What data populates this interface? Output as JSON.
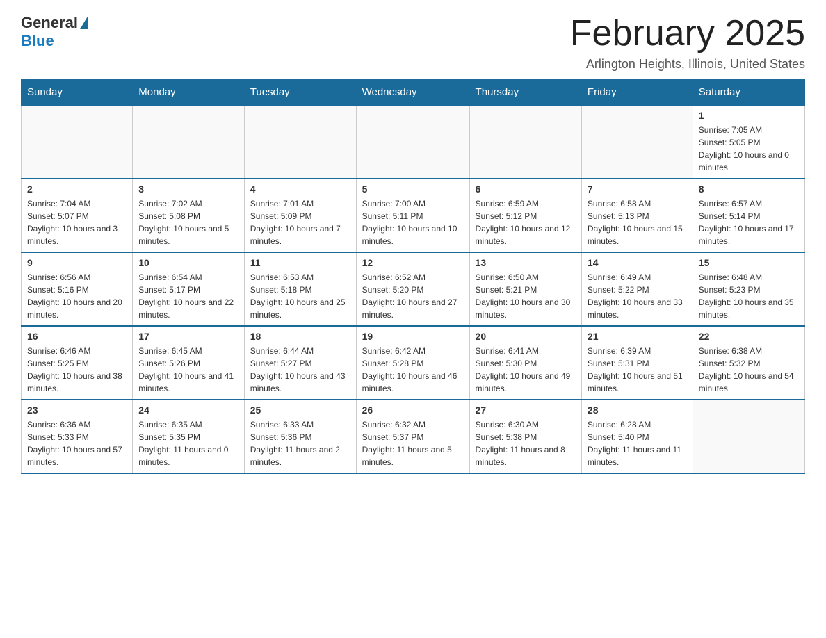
{
  "header": {
    "logo_general": "General",
    "logo_blue": "Blue",
    "month_title": "February 2025",
    "location": "Arlington Heights, Illinois, United States"
  },
  "days_of_week": [
    "Sunday",
    "Monday",
    "Tuesday",
    "Wednesday",
    "Thursday",
    "Friday",
    "Saturday"
  ],
  "weeks": [
    [
      {
        "day": "",
        "info": ""
      },
      {
        "day": "",
        "info": ""
      },
      {
        "day": "",
        "info": ""
      },
      {
        "day": "",
        "info": ""
      },
      {
        "day": "",
        "info": ""
      },
      {
        "day": "",
        "info": ""
      },
      {
        "day": "1",
        "info": "Sunrise: 7:05 AM\nSunset: 5:05 PM\nDaylight: 10 hours and 0 minutes."
      }
    ],
    [
      {
        "day": "2",
        "info": "Sunrise: 7:04 AM\nSunset: 5:07 PM\nDaylight: 10 hours and 3 minutes."
      },
      {
        "day": "3",
        "info": "Sunrise: 7:02 AM\nSunset: 5:08 PM\nDaylight: 10 hours and 5 minutes."
      },
      {
        "day": "4",
        "info": "Sunrise: 7:01 AM\nSunset: 5:09 PM\nDaylight: 10 hours and 7 minutes."
      },
      {
        "day": "5",
        "info": "Sunrise: 7:00 AM\nSunset: 5:11 PM\nDaylight: 10 hours and 10 minutes."
      },
      {
        "day": "6",
        "info": "Sunrise: 6:59 AM\nSunset: 5:12 PM\nDaylight: 10 hours and 12 minutes."
      },
      {
        "day": "7",
        "info": "Sunrise: 6:58 AM\nSunset: 5:13 PM\nDaylight: 10 hours and 15 minutes."
      },
      {
        "day": "8",
        "info": "Sunrise: 6:57 AM\nSunset: 5:14 PM\nDaylight: 10 hours and 17 minutes."
      }
    ],
    [
      {
        "day": "9",
        "info": "Sunrise: 6:56 AM\nSunset: 5:16 PM\nDaylight: 10 hours and 20 minutes."
      },
      {
        "day": "10",
        "info": "Sunrise: 6:54 AM\nSunset: 5:17 PM\nDaylight: 10 hours and 22 minutes."
      },
      {
        "day": "11",
        "info": "Sunrise: 6:53 AM\nSunset: 5:18 PM\nDaylight: 10 hours and 25 minutes."
      },
      {
        "day": "12",
        "info": "Sunrise: 6:52 AM\nSunset: 5:20 PM\nDaylight: 10 hours and 27 minutes."
      },
      {
        "day": "13",
        "info": "Sunrise: 6:50 AM\nSunset: 5:21 PM\nDaylight: 10 hours and 30 minutes."
      },
      {
        "day": "14",
        "info": "Sunrise: 6:49 AM\nSunset: 5:22 PM\nDaylight: 10 hours and 33 minutes."
      },
      {
        "day": "15",
        "info": "Sunrise: 6:48 AM\nSunset: 5:23 PM\nDaylight: 10 hours and 35 minutes."
      }
    ],
    [
      {
        "day": "16",
        "info": "Sunrise: 6:46 AM\nSunset: 5:25 PM\nDaylight: 10 hours and 38 minutes."
      },
      {
        "day": "17",
        "info": "Sunrise: 6:45 AM\nSunset: 5:26 PM\nDaylight: 10 hours and 41 minutes."
      },
      {
        "day": "18",
        "info": "Sunrise: 6:44 AM\nSunset: 5:27 PM\nDaylight: 10 hours and 43 minutes."
      },
      {
        "day": "19",
        "info": "Sunrise: 6:42 AM\nSunset: 5:28 PM\nDaylight: 10 hours and 46 minutes."
      },
      {
        "day": "20",
        "info": "Sunrise: 6:41 AM\nSunset: 5:30 PM\nDaylight: 10 hours and 49 minutes."
      },
      {
        "day": "21",
        "info": "Sunrise: 6:39 AM\nSunset: 5:31 PM\nDaylight: 10 hours and 51 minutes."
      },
      {
        "day": "22",
        "info": "Sunrise: 6:38 AM\nSunset: 5:32 PM\nDaylight: 10 hours and 54 minutes."
      }
    ],
    [
      {
        "day": "23",
        "info": "Sunrise: 6:36 AM\nSunset: 5:33 PM\nDaylight: 10 hours and 57 minutes."
      },
      {
        "day": "24",
        "info": "Sunrise: 6:35 AM\nSunset: 5:35 PM\nDaylight: 11 hours and 0 minutes."
      },
      {
        "day": "25",
        "info": "Sunrise: 6:33 AM\nSunset: 5:36 PM\nDaylight: 11 hours and 2 minutes."
      },
      {
        "day": "26",
        "info": "Sunrise: 6:32 AM\nSunset: 5:37 PM\nDaylight: 11 hours and 5 minutes."
      },
      {
        "day": "27",
        "info": "Sunrise: 6:30 AM\nSunset: 5:38 PM\nDaylight: 11 hours and 8 minutes."
      },
      {
        "day": "28",
        "info": "Sunrise: 6:28 AM\nSunset: 5:40 PM\nDaylight: 11 hours and 11 minutes."
      },
      {
        "day": "",
        "info": ""
      }
    ]
  ]
}
